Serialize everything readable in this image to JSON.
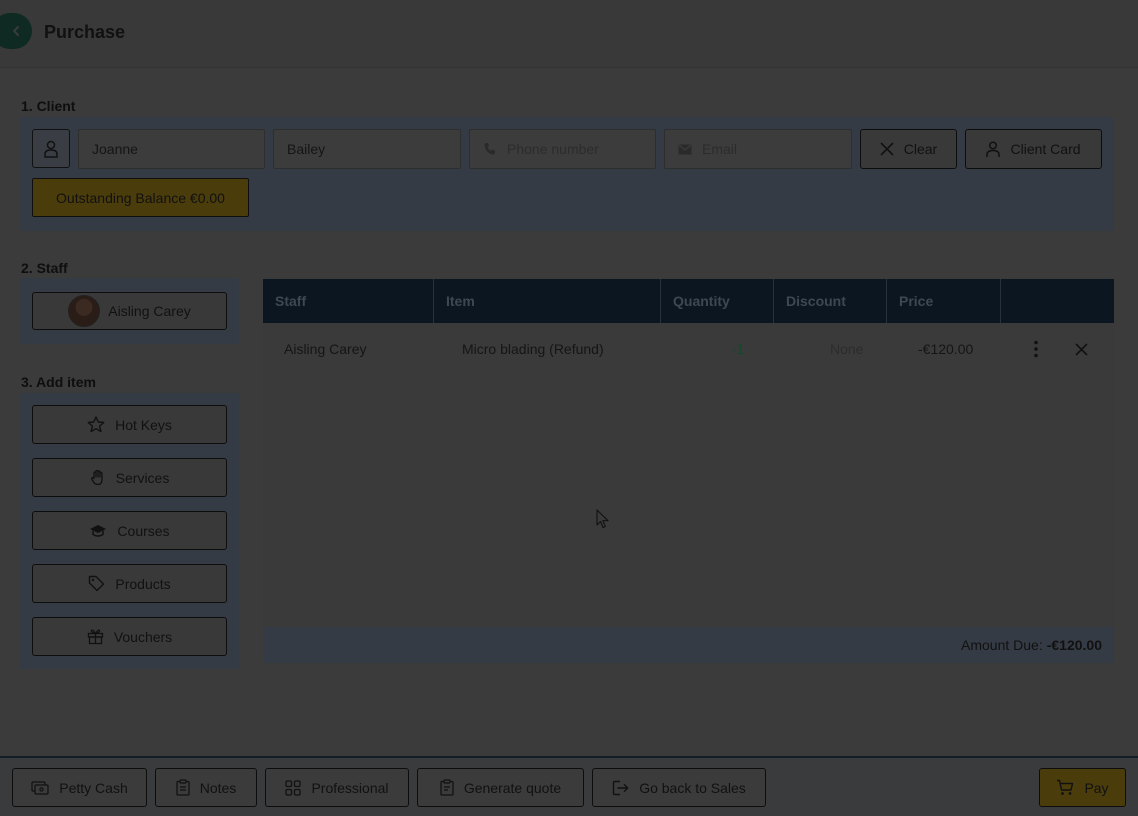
{
  "header": {
    "title": "Purchase"
  },
  "client": {
    "section_label": "1. Client",
    "first_name": "Joanne",
    "last_name": "Bailey",
    "phone_placeholder": "Phone number",
    "email_placeholder": "Email",
    "clear_label": "Clear",
    "client_card_label": "Client Card",
    "balance_label": "Outstanding Balance €0.00"
  },
  "staff": {
    "section_label": "2. Staff",
    "selected_name": "Aisling Carey"
  },
  "add_item": {
    "section_label": "3. Add item",
    "buttons": [
      {
        "label": "Hot Keys",
        "icon": "star-icon"
      },
      {
        "label": "Services",
        "icon": "hand-icon"
      },
      {
        "label": "Courses",
        "icon": "graduation-cap-icon"
      },
      {
        "label": "Products",
        "icon": "tag-icon"
      },
      {
        "label": "Vouchers",
        "icon": "gift-icon"
      }
    ]
  },
  "table": {
    "columns": [
      "Staff",
      "Item",
      "Quantity",
      "Discount",
      "Price"
    ],
    "rows": [
      {
        "staff": "Aisling Carey",
        "item": "Micro blading (Refund)",
        "quantity": "-1",
        "discount": "None",
        "price": "-€120.00"
      }
    ],
    "amount_due_label": "Amount Due:",
    "amount_due_value": "-€120.00"
  },
  "bottom_bar": {
    "petty_cash": "Petty Cash",
    "notes": "Notes",
    "professional": "Professional",
    "generate_quote": "Generate quote",
    "go_back": "Go back to Sales",
    "pay": "Pay"
  },
  "colors": {
    "accent_dark_green": "#0f2a22",
    "balance_yellow": "#4b3d0b",
    "table_header": "#0b1620",
    "panel_blue": "#353b44",
    "quantity_green": "#0f4a2a"
  }
}
